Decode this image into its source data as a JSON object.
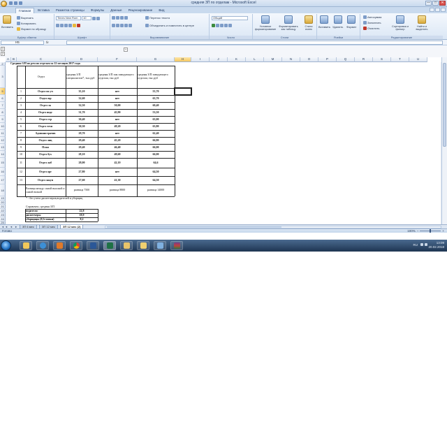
{
  "window": {
    "title": "средняя ЗП по отделам - Microsoft Excel",
    "controls": [
      "—",
      "□",
      "✕"
    ]
  },
  "ribbon_tabs": [
    "Главная",
    "Вставка",
    "Разметка страницы",
    "Формулы",
    "Данные",
    "Рецензирование",
    "Вид"
  ],
  "ribbon": {
    "clipboard": {
      "paste": "Вставить",
      "cut": "Вырезать",
      "copy": "Копировать",
      "format_painter": "Формат по образцу",
      "label": "Буфер обмена"
    },
    "font": {
      "name": "Times New Rom",
      "size": "10",
      "label": "Шрифт"
    },
    "alignment": {
      "wrap": "Перенос текста",
      "merge": "Объединить и поместить в центре",
      "label": "Выравнивание"
    },
    "number": {
      "format": "Общий",
      "label": "Число"
    },
    "styles": {
      "conditional": "Условное форматирование",
      "as_table": "Форматировать как таблицу",
      "cell_styles": "Стили ячеек",
      "label": "Стили"
    },
    "cells": {
      "insert": "Вставить",
      "delete": "Удалить",
      "format": "Формат",
      "label": "Ячейки"
    },
    "editing": {
      "autosum": "Автосумма",
      "fill": "Заполнить",
      "clear": "Очистить",
      "sort": "Сортировка и фильтр",
      "find": "Найти и выделить",
      "label": "Редактирование"
    }
  },
  "formula_bar": {
    "name_box": "H5",
    "fx": "fx",
    "formula": ""
  },
  "outline": {
    "levels": [
      "1",
      "2"
    ],
    "expand": "+"
  },
  "columns": [
    "A",
    "B",
    "C",
    "D",
    "F",
    "G",
    "H",
    "I",
    "J",
    "K",
    "L",
    "M",
    "N",
    "O",
    "P",
    "Q",
    "R",
    "S",
    "T",
    "U"
  ],
  "rows": [
    "2",
    "3",
    "5",
    "6",
    "7",
    "8",
    "9",
    "10",
    "11",
    "12",
    "13",
    "14",
    "15",
    "16",
    "17",
    "18",
    "19",
    "20",
    "21",
    "22",
    "23",
    "24",
    "25"
  ],
  "sheet": {
    "title": "Средняя З/П по рем по отделам за 12 месяцев 2017 года",
    "headers": {
      "dept": "Отдел",
      "avg_specialist": "средняя З/П специалистов*, тыс.руб",
      "avg_deputy": "средняя З/П зам.заведующего отделом, тыс.руб",
      "avg_head": "средняя З/П заведующего отделом, тыс.руб"
    },
    "rows": [
      {
        "n": "1",
        "dept": "Отдел по уч",
        "spec": "35,10",
        "deputy": "нет",
        "head": "55,70"
      },
      {
        "n": "2",
        "dept": "Отдел юр",
        "spec": "32,60",
        "deputy": "нет",
        "head": "63,70"
      },
      {
        "n": "3",
        "dept": "Отдел эк",
        "spec": "32,50",
        "deputy": "50,00",
        "head": "60,40"
      },
      {
        "n": "4",
        "dept": "Отдел подг",
        "spec": "31,70",
        "deputy": "45,90",
        "head": "53,50"
      },
      {
        "n": "5",
        "dept": "Отдел стр",
        "spec": "30,40",
        "deputy": "нет",
        "head": "63,00"
      },
      {
        "n": "6",
        "dept": "Отдел техн",
        "spec": "30,30",
        "deputy": "49,20",
        "head": "63,80"
      },
      {
        "n": "7",
        "dept": "Административ",
        "spec": "29,70",
        "deputy": "нет",
        "head": "62,40"
      },
      {
        "n": "8",
        "dept": "Отдел лиц",
        "spec": "29,40",
        "deputy": "45,20",
        "head": "66,80"
      },
      {
        "n": "9",
        "dept": "План",
        "spec": "29,40",
        "deputy": "46,40",
        "head": "66,00"
      },
      {
        "n": "10",
        "dept": "Отдел бух",
        "spec": "28,10",
        "deputy": "49,60",
        "head": "66,00"
      },
      {
        "n": "11",
        "dept": "Отдел лаб",
        "spec": "28,00",
        "deputy": "42,10",
        "head": "64,6"
      },
      {
        "n": "12",
        "dept": "Отдел орг",
        "spec": "27,80",
        "deputy": "нет",
        "head": "64,50"
      },
      {
        "n": "13",
        "dept": "Отдел закуп",
        "spec": "27,60",
        "deputy": "41,30",
        "head": "64,50"
      }
    ],
    "diff": {
      "label": "Разница между самой высокой и самой низкой",
      "spec": "разница 7500",
      "deputy": "разница 8800",
      "head": "разница 14000"
    },
    "footnote": "* - без учета диспетчеров,водителей и уборщиц",
    "ref_title": "Справочно, средняя З/П",
    "ref_rows": [
      {
        "label": "водители",
        "value": "22,8"
      },
      {
        "label": "диспетчеры",
        "value": "18,9"
      },
      {
        "label": "уборщицы (0,5ставки)",
        "value": "8,2"
      }
    ]
  },
  "sheet_tabs": [
    "ЗП 6 мес",
    "ЗП 12 мес",
    "ЗП 12 мес (2)"
  ],
  "sheet_nav": "◄◄ ◄ ► ►►",
  "status": {
    "ready": "Готово",
    "zoom": "100%"
  },
  "taskbar": {
    "lang": "RU",
    "time": "13:09",
    "date": "20.02.2018"
  },
  "colors": {
    "accent": "#f7c85e",
    "ribbon": "#dbe7f5",
    "taskbar": "#1e3552"
  }
}
